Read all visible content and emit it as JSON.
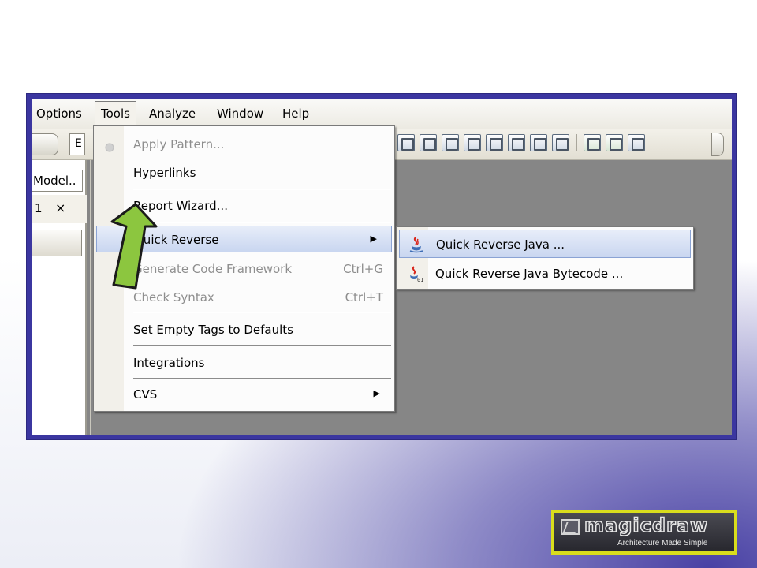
{
  "menubar": {
    "items": [
      {
        "label": "Options"
      },
      {
        "label": "Tools"
      },
      {
        "label": "Analyze"
      },
      {
        "label": "Window"
      },
      {
        "label": "Help"
      }
    ]
  },
  "toolbar": {
    "left_field_value": "E"
  },
  "left_panel": {
    "tab_label": "Model..",
    "row_label": "1",
    "close_glyph": "×"
  },
  "tools_menu": {
    "items": [
      {
        "label": "Apply Pattern...",
        "enabled": false,
        "icon": "apply-pattern-icon"
      },
      {
        "label": "Hyperlinks",
        "enabled": true
      },
      {
        "label": "Report Wizard...",
        "enabled": true
      },
      {
        "label": "Quick Reverse",
        "enabled": true,
        "submenu": true,
        "highlighted": true
      },
      {
        "label": "Generate Code Framework",
        "enabled": false,
        "shortcut": "Ctrl+G"
      },
      {
        "label": "Check Syntax",
        "enabled": false,
        "shortcut": "Ctrl+T"
      },
      {
        "label": "Set Empty Tags to Defaults",
        "enabled": true
      },
      {
        "label": "Integrations",
        "enabled": true
      },
      {
        "label": "CVS",
        "enabled": true,
        "submenu": true
      }
    ]
  },
  "quick_reverse_submenu": {
    "items": [
      {
        "label": "Quick Reverse Java ...",
        "icon": "java-cup-icon",
        "highlighted": true
      },
      {
        "label": "Quick Reverse Java Bytecode ...",
        "icon": "java-bytecode-icon"
      }
    ]
  },
  "logo": {
    "wordmark": "magicdraw",
    "tagline": "Architecture Made Simple"
  },
  "colors": {
    "frame_border": "#3b36a0",
    "menu_highlight": "#c9d6f0",
    "arrow_green": "#8cc63f",
    "logo_border": "#d9dd1c"
  }
}
